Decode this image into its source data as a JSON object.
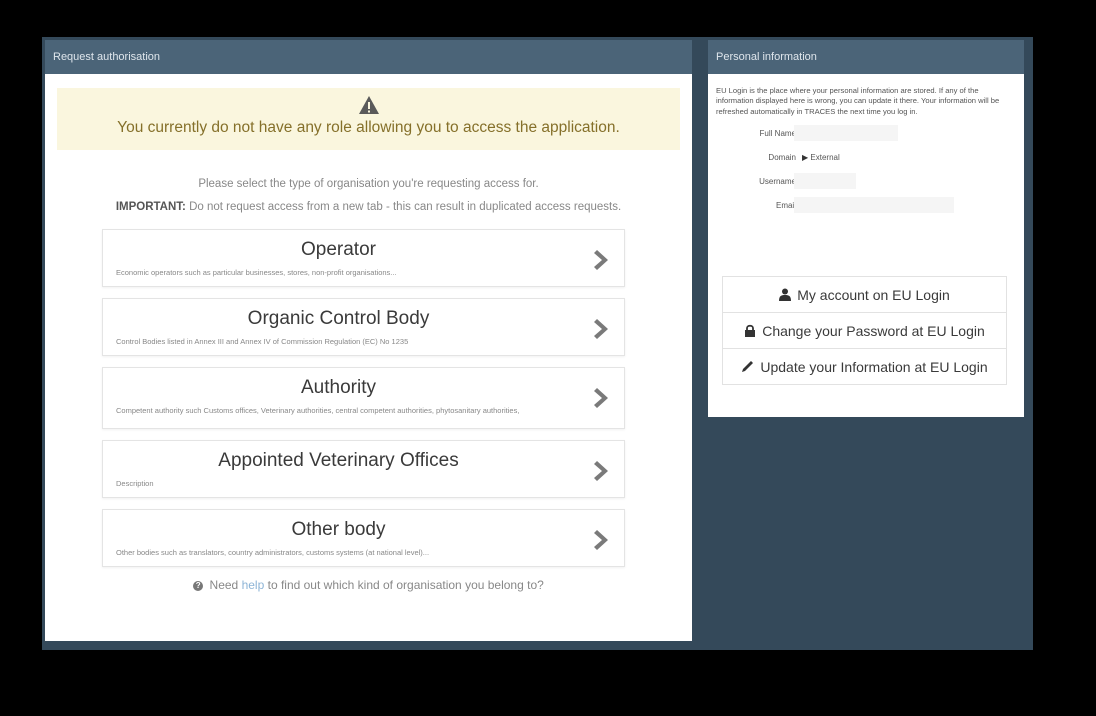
{
  "request_panel": {
    "heading": "Request authorisation",
    "warning_text": "You currently do not have any role allowing you to access the application.",
    "select_prompt": "Please select the type of organisation you're requesting access for.",
    "important_label": "IMPORTANT:",
    "important_text": "Do not request access from a new tab - this can result in duplicated access requests.",
    "organisations": [
      {
        "title": "Operator",
        "description": "Economic operators such as particular businesses, stores, non-profit organisations..."
      },
      {
        "title": "Organic Control Body",
        "description": "Control Bodies listed in Annex III and Annex IV of Commission Regulation (EC) No 1235"
      },
      {
        "title": "Authority",
        "description": "Competent authority such Customs offices, Veterinary authorities, central competent authorities, phytosanitary authorities,"
      },
      {
        "title": "Appointed Veterinary Offices",
        "description": "Description"
      },
      {
        "title": "Other body",
        "description": "Other bodies such as translators, country administrators, customs systems (at national level)..."
      }
    ],
    "help_prefix": "Need",
    "help_link": "help",
    "help_suffix": "to find out which kind of organisation you belong to?"
  },
  "personal_panel": {
    "heading": "Personal information",
    "info_text": "EU Login is the place where your personal information are stored. If any of the information displayed here is wrong, you can update it there. Your information will be refreshed automatically in TRACES the next time you log in.",
    "fields": {
      "full_name_label": "Full Name",
      "domain_label": "Domain",
      "domain_value": "External",
      "username_label": "Username",
      "email_label": "Email"
    },
    "buttons": {
      "my_account": "My account on EU Login",
      "change_password": "Change your Password at EU Login",
      "update_info": "Update your Information at EU Login"
    }
  },
  "colors": {
    "background": "#000000",
    "frame": "#34495a",
    "panel_heading": "#4b6478",
    "warning_bg": "#faf6de",
    "warning_text": "#85702a",
    "link": "#8db4d6"
  },
  "icons": [
    "warning-icon",
    "chevron-right-icon",
    "question-circle-icon",
    "user-icon",
    "lock-icon",
    "pencil-icon",
    "sign-in-icon"
  ]
}
